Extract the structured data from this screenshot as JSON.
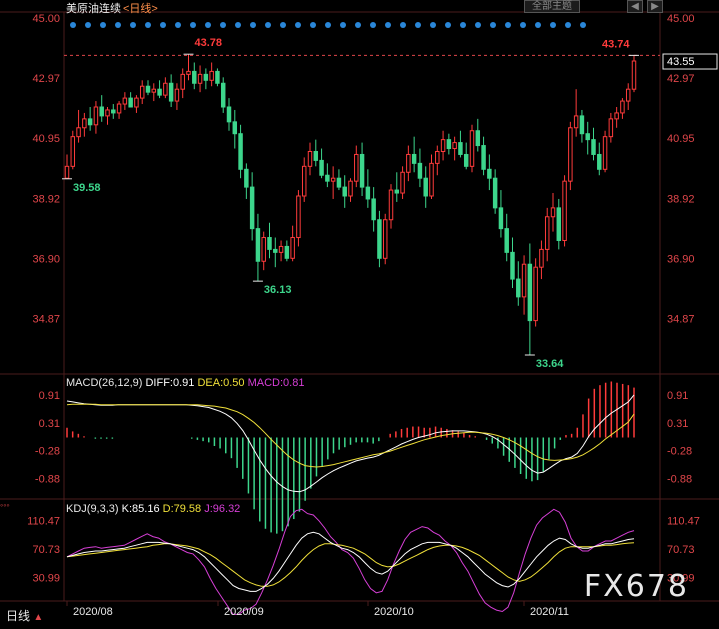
{
  "header": {
    "instrument": "美原油连续",
    "period_tag": "<日线>",
    "theme_button": "全部主题",
    "nav_left": "◀",
    "nav_right": "▶"
  },
  "bottom": {
    "period_label": "日线",
    "period_arrow": "▲",
    "small_mark": "◦◦◦"
  },
  "watermark": "FX678",
  "colors": {
    "up": "#ff3b3b",
    "down": "#3dd68c",
    "axis_text": "#e0464a",
    "grid": "#3a1a1a",
    "dea": "#f0e03a",
    "k": "#ffffff",
    "d": "#f0e03a",
    "j": "#d63fd6",
    "macd_text": "#d63fd6"
  },
  "chart_data": [
    {
      "type": "candlestick",
      "title": "美原油连续<日线>",
      "ylim": [
        33.0,
        45.0
      ],
      "y_ticks": [
        "45.00",
        "42.97",
        "40.95",
        "38.92",
        "36.90",
        "34.87"
      ],
      "x_ticks": [
        "2020/08",
        "2020/09",
        "2020/10",
        "2020/11"
      ],
      "last_price_label": "43.55",
      "dashed_line_value": 43.74,
      "annotations": [
        {
          "text": "43.78",
          "value": 43.78
        },
        {
          "text": "43.74",
          "value": 43.74
        },
        {
          "text": "39.58",
          "value": 39.58
        },
        {
          "text": "36.13",
          "value": 36.13
        },
        {
          "text": "33.64",
          "value": 33.64
        }
      ],
      "candles": [
        [
          39.6,
          40.4,
          39.58,
          40.0
        ],
        [
          40.0,
          41.2,
          39.9,
          41.0
        ],
        [
          41.0,
          41.9,
          40.8,
          41.3
        ],
        [
          41.3,
          41.8,
          41.0,
          41.6
        ],
        [
          41.6,
          42.0,
          41.2,
          41.4
        ],
        [
          41.4,
          42.2,
          41.1,
          42.0
        ],
        [
          42.0,
          42.4,
          41.5,
          41.7
        ],
        [
          41.7,
          42.0,
          41.4,
          41.9
        ],
        [
          41.9,
          42.1,
          41.6,
          41.8
        ],
        [
          41.8,
          42.2,
          41.6,
          42.1
        ],
        [
          42.1,
          42.5,
          41.9,
          42.3
        ],
        [
          42.3,
          42.5,
          42.0,
          42.0
        ],
        [
          42.0,
          42.4,
          41.8,
          42.3
        ],
        [
          42.3,
          42.9,
          42.1,
          42.7
        ],
        [
          42.7,
          42.9,
          42.4,
          42.5
        ],
        [
          42.5,
          42.8,
          42.2,
          42.6
        ],
        [
          42.6,
          42.9,
          42.3,
          42.4
        ],
        [
          42.4,
          43.0,
          42.3,
          42.8
        ],
        [
          42.8,
          43.1,
          42.0,
          42.2
        ],
        [
          42.2,
          42.8,
          41.9,
          42.6
        ],
        [
          42.6,
          43.3,
          42.3,
          43.1
        ],
        [
          43.1,
          43.78,
          42.9,
          43.2
        ],
        [
          43.2,
          43.5,
          42.6,
          42.8
        ],
        [
          42.8,
          43.4,
          42.5,
          43.1
        ],
        [
          43.1,
          43.3,
          42.6,
          42.9
        ],
        [
          42.9,
          43.5,
          42.7,
          43.2
        ],
        [
          43.2,
          43.3,
          42.7,
          42.8
        ],
        [
          42.8,
          43.0,
          41.8,
          42.0
        ],
        [
          42.0,
          42.3,
          41.2,
          41.5
        ],
        [
          41.5,
          41.9,
          40.6,
          41.1
        ],
        [
          41.1,
          41.4,
          39.6,
          39.9
        ],
        [
          39.9,
          40.1,
          38.9,
          39.3
        ],
        [
          39.3,
          39.8,
          37.5,
          37.9
        ],
        [
          37.9,
          38.4,
          36.13,
          36.8
        ],
        [
          36.8,
          37.8,
          36.5,
          37.6
        ],
        [
          37.6,
          38.1,
          36.9,
          37.2
        ],
        [
          37.2,
          37.6,
          36.6,
          37.1
        ],
        [
          37.1,
          37.5,
          36.8,
          37.3
        ],
        [
          37.3,
          37.5,
          36.8,
          36.9
        ],
        [
          36.9,
          38.0,
          36.8,
          37.6
        ],
        [
          37.6,
          39.2,
          37.3,
          39.0
        ],
        [
          39.0,
          40.3,
          38.8,
          40.0
        ],
        [
          40.0,
          40.8,
          39.7,
          40.5
        ],
        [
          40.5,
          40.9,
          40.0,
          40.2
        ],
        [
          40.2,
          40.6,
          39.6,
          39.7
        ],
        [
          39.7,
          40.1,
          39.3,
          39.5
        ],
        [
          39.5,
          40.0,
          38.9,
          39.6
        ],
        [
          39.6,
          39.9,
          39.2,
          39.3
        ],
        [
          39.3,
          39.7,
          38.6,
          39.0
        ],
        [
          39.0,
          39.6,
          38.8,
          39.5
        ],
        [
          39.5,
          40.7,
          39.3,
          40.4
        ],
        [
          40.4,
          40.8,
          39.0,
          39.3
        ],
        [
          39.3,
          39.9,
          38.6,
          38.9
        ],
        [
          38.9,
          39.3,
          37.8,
          38.2
        ],
        [
          38.2,
          38.5,
          36.6,
          36.9
        ],
        [
          36.9,
          38.4,
          36.7,
          38.2
        ],
        [
          38.2,
          39.4,
          37.9,
          39.2
        ],
        [
          39.2,
          39.8,
          38.8,
          39.1
        ],
        [
          39.1,
          40.0,
          38.9,
          39.8
        ],
        [
          39.8,
          40.7,
          39.5,
          40.4
        ],
        [
          40.4,
          41.0,
          39.8,
          40.1
        ],
        [
          40.1,
          40.6,
          39.3,
          39.6
        ],
        [
          39.6,
          40.0,
          38.6,
          39.0
        ],
        [
          39.0,
          40.4,
          38.9,
          40.1
        ],
        [
          40.1,
          40.7,
          39.7,
          40.5
        ],
        [
          40.5,
          41.2,
          40.2,
          40.9
        ],
        [
          40.9,
          41.1,
          40.4,
          40.6
        ],
        [
          40.6,
          41.0,
          40.2,
          40.8
        ],
        [
          40.8,
          41.2,
          40.3,
          40.4
        ],
        [
          40.4,
          40.8,
          39.9,
          40.0
        ],
        [
          40.0,
          41.4,
          39.8,
          41.2
        ],
        [
          41.2,
          41.6,
          40.5,
          40.7
        ],
        [
          40.7,
          41.0,
          39.7,
          39.9
        ],
        [
          39.9,
          40.4,
          39.2,
          39.6
        ],
        [
          39.6,
          39.9,
          38.4,
          38.6
        ],
        [
          38.6,
          39.2,
          37.6,
          37.9
        ],
        [
          37.9,
          38.4,
          36.8,
          37.1
        ],
        [
          37.1,
          37.6,
          35.9,
          36.2
        ],
        [
          36.2,
          36.8,
          35.3,
          35.6
        ],
        [
          35.6,
          37.0,
          35.0,
          36.7
        ],
        [
          36.7,
          37.4,
          33.64,
          34.8
        ],
        [
          34.8,
          36.9,
          34.6,
          36.6
        ],
        [
          36.6,
          37.5,
          36.2,
          37.2
        ],
        [
          37.2,
          38.6,
          36.8,
          38.3
        ],
        [
          38.3,
          39.1,
          37.8,
          38.6
        ],
        [
          38.6,
          38.9,
          37.2,
          37.5
        ],
        [
          37.5,
          39.7,
          37.3,
          39.5
        ],
        [
          39.5,
          41.5,
          39.2,
          41.3
        ],
        [
          41.3,
          42.6,
          41.0,
          41.7
        ],
        [
          41.7,
          41.9,
          40.8,
          41.1
        ],
        [
          41.1,
          41.5,
          40.4,
          40.9
        ],
        [
          40.9,
          41.3,
          40.2,
          40.4
        ],
        [
          40.4,
          40.8,
          39.7,
          39.9
        ],
        [
          39.9,
          41.2,
          39.8,
          41.0
        ],
        [
          41.0,
          41.8,
          40.8,
          41.6
        ],
        [
          41.6,
          42.0,
          41.3,
          41.8
        ],
        [
          41.8,
          42.3,
          41.6,
          42.2
        ],
        [
          42.2,
          42.8,
          41.9,
          42.6
        ],
        [
          42.6,
          43.74,
          42.5,
          43.55
        ]
      ]
    },
    {
      "type": "macd",
      "params": "MACD(26,12,9)",
      "DIFF": 0.91,
      "DEA": 0.5,
      "MACD": 0.81,
      "labels": {
        "params": "MACD(26,12,9)",
        "diff": "DIFF:0.91",
        "dea": "DEA:0.50",
        "macd": "MACD:0.81"
      },
      "ylim": [
        -1.25,
        1.1
      ],
      "y_ticks": [
        "0.91",
        "0.31",
        "-0.28",
        "-0.88"
      ],
      "diff": [
        0.78,
        0.76,
        0.74,
        0.72,
        0.71,
        0.7,
        0.69,
        0.69,
        0.69,
        0.7,
        0.7,
        0.7,
        0.7,
        0.7,
        0.7,
        0.7,
        0.7,
        0.7,
        0.7,
        0.7,
        0.7,
        0.7,
        0.69,
        0.68,
        0.66,
        0.64,
        0.6,
        0.56,
        0.5,
        0.42,
        0.3,
        0.15,
        -0.05,
        -0.27,
        -0.48,
        -0.66,
        -0.82,
        -0.95,
        -1.05,
        -1.12,
        -1.15,
        -1.16,
        -1.12,
        -1.04,
        -0.95,
        -0.86,
        -0.78,
        -0.71,
        -0.65,
        -0.6,
        -0.55,
        -0.5,
        -0.47,
        -0.44,
        -0.42,
        -0.38,
        -0.32,
        -0.26,
        -0.2,
        -0.14,
        -0.09,
        -0.04,
        0.0,
        0.03,
        0.06,
        0.1,
        0.12,
        0.13,
        0.14,
        0.14,
        0.14,
        0.13,
        0.12,
        0.1,
        0.07,
        0.02,
        -0.05,
        -0.15,
        -0.25,
        -0.36,
        -0.48,
        -0.6,
        -0.7,
        -0.76,
        -0.74,
        -0.66,
        -0.58,
        -0.5,
        -0.45,
        -0.42,
        -0.34,
        -0.18,
        0.02,
        0.18,
        0.3,
        0.42,
        0.52,
        0.6,
        0.68,
        0.76,
        0.91
      ],
      "dea": [
        0.7,
        0.71,
        0.71,
        0.71,
        0.71,
        0.71,
        0.7,
        0.7,
        0.7,
        0.7,
        0.7,
        0.7,
        0.7,
        0.7,
        0.7,
        0.7,
        0.7,
        0.7,
        0.7,
        0.7,
        0.7,
        0.7,
        0.7,
        0.7,
        0.69,
        0.68,
        0.67,
        0.65,
        0.63,
        0.59,
        0.55,
        0.49,
        0.41,
        0.32,
        0.21,
        0.09,
        -0.04,
        -0.16,
        -0.28,
        -0.39,
        -0.48,
        -0.55,
        -0.6,
        -0.62,
        -0.63,
        -0.62,
        -0.6,
        -0.58,
        -0.55,
        -0.52,
        -0.49,
        -0.46,
        -0.43,
        -0.4,
        -0.37,
        -0.35,
        -0.32,
        -0.29,
        -0.25,
        -0.21,
        -0.17,
        -0.13,
        -0.09,
        -0.05,
        -0.02,
        0.01,
        0.04,
        0.06,
        0.08,
        0.09,
        0.1,
        0.11,
        0.11,
        0.1,
        0.09,
        0.07,
        0.04,
        0.0,
        -0.05,
        -0.11,
        -0.18,
        -0.26,
        -0.34,
        -0.41,
        -0.46,
        -0.48,
        -0.49,
        -0.48,
        -0.47,
        -0.45,
        -0.42,
        -0.37,
        -0.3,
        -0.22,
        -0.13,
        -0.03,
        0.06,
        0.15,
        0.24,
        0.33,
        0.5
      ]
    },
    {
      "type": "kdj",
      "params": "KDJ(9,3,3)",
      "K": 85.16,
      "D": 79.58,
      "J": 96.32,
      "labels": {
        "params": "KDJ(9,3,3)",
        "k": "K:85.16",
        "d": "D:79.58",
        "j": "J:96.32"
      },
      "ylim": [
        0,
        125
      ],
      "y_ticks": [
        "110.47",
        "70.73",
        "30.99"
      ],
      "k": [
        60,
        62,
        64,
        66,
        67,
        68,
        68,
        69,
        70,
        71,
        72,
        74,
        76,
        78,
        80,
        80,
        80,
        79,
        78,
        76,
        74,
        72,
        70,
        66,
        60,
        52,
        44,
        36,
        28,
        20,
        16,
        14,
        12,
        12,
        16,
        22,
        30,
        40,
        52,
        64,
        76,
        86,
        92,
        94,
        92,
        86,
        80,
        76,
        72,
        70,
        66,
        60,
        52,
        44,
        38,
        36,
        40,
        48,
        56,
        64,
        70,
        74,
        78,
        80,
        80,
        80,
        78,
        76,
        72,
        66,
        60,
        52,
        44,
        36,
        30,
        24,
        20,
        18,
        22,
        30,
        40,
        50,
        60,
        68,
        76,
        82,
        86,
        84,
        78,
        74,
        72,
        72,
        74,
        76,
        78,
        78,
        80,
        82,
        84,
        85.16
      ],
      "d": [
        60,
        61,
        62,
        63,
        64,
        65,
        66,
        67,
        68,
        69,
        70,
        71,
        72,
        73,
        74,
        76,
        77,
        78,
        78,
        77,
        76,
        75,
        73,
        71,
        67,
        63,
        58,
        52,
        46,
        40,
        34,
        28,
        24,
        21,
        19,
        19,
        21,
        25,
        31,
        38,
        46,
        55,
        63,
        70,
        75,
        78,
        78,
        77,
        76,
        74,
        72,
        68,
        64,
        58,
        52,
        48,
        46,
        47,
        50,
        54,
        58,
        62,
        66,
        70,
        73,
        75,
        76,
        76,
        75,
        73,
        70,
        66,
        62,
        56,
        50,
        44,
        38,
        32,
        28,
        26,
        28,
        32,
        38,
        45,
        52,
        60,
        67,
        72,
        74,
        74,
        74,
        74,
        74,
        75,
        76,
        76,
        77,
        78,
        79,
        79.58
      ],
      "j": [
        60,
        64,
        68,
        72,
        73,
        74,
        72,
        73,
        74,
        75,
        76,
        80,
        84,
        88,
        92,
        88,
        86,
        81,
        78,
        74,
        70,
        66,
        64,
        56,
        46,
        30,
        16,
        4,
        -8,
        -20,
        -20,
        -14,
        -12,
        -6,
        10,
        28,
        48,
        70,
        94,
        116,
        124,
        126,
        120,
        118,
        110,
        100,
        88,
        80,
        70,
        66,
        58,
        44,
        28,
        16,
        10,
        12,
        28,
        50,
        68,
        84,
        94,
        98,
        102,
        100,
        94,
        90,
        82,
        76,
        66,
        52,
        40,
        24,
        8,
        -4,
        -10,
        -14,
        -16,
        -10,
        10,
        38,
        64,
        86,
        104,
        114,
        120,
        126,
        122,
        108,
        86,
        74,
        68,
        68,
        74,
        78,
        82,
        82,
        86,
        90,
        94,
        96.32
      ]
    }
  ]
}
